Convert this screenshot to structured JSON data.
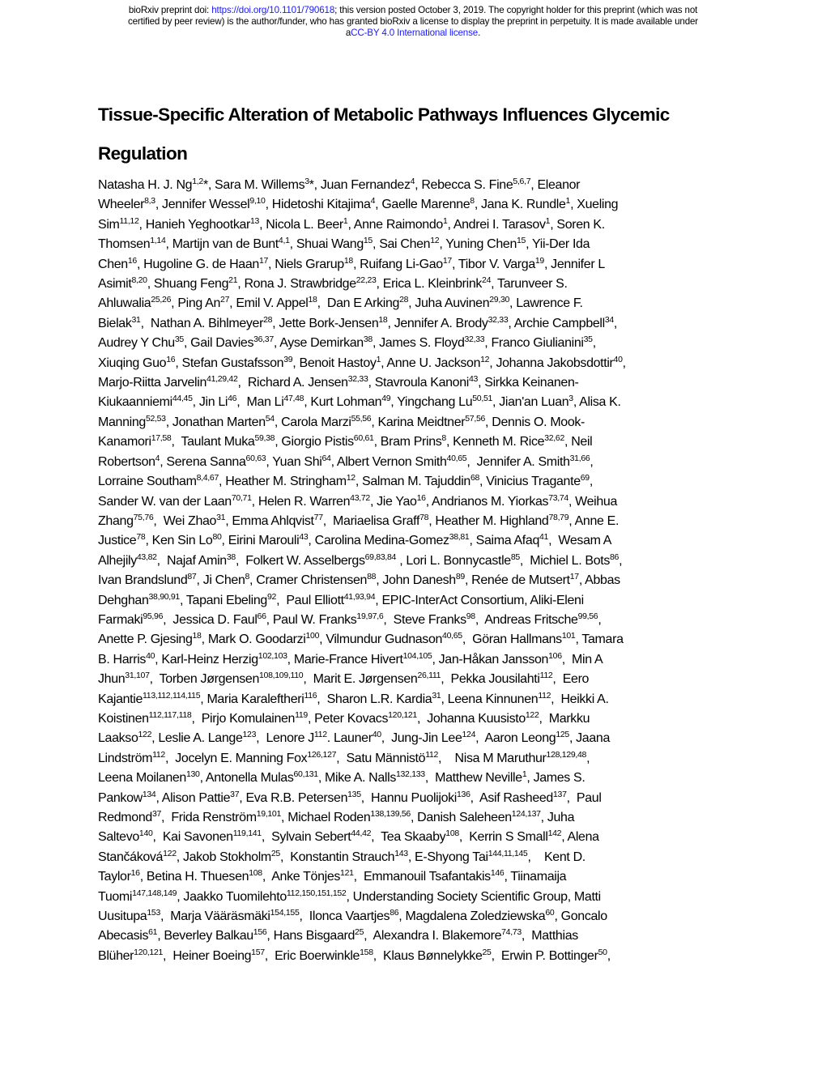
{
  "header_notice": {
    "prefix": "bioRxiv preprint doi: ",
    "doi_link": "https://doi.org/10.1101/790618",
    "line1_suffix": "; this version posted October 3, 2019. The copyright holder for this preprint (which was not",
    "line2": "certified by peer review) is the author/funder, who has granted bioRxiv a license to display the preprint in perpetuity. It is made available under",
    "line3_prefix": "a",
    "license_link": "CC-BY 4.0 International license",
    "line3_suffix": "."
  },
  "paper": {
    "title_line1": "Tissue-Specific Alteration of Metabolic Pathways Influences Glycemic",
    "title_line2": "Regulation"
  },
  "author_lines": [
    [
      [
        "Natasha H. J. Ng",
        "1,2",
        "*, "
      ],
      [
        "Sara M. Willems",
        "3",
        "*, "
      ],
      [
        "Juan Fernandez",
        "4",
        ", "
      ],
      [
        "Rebecca S. Fine",
        "5,6,7",
        ", "
      ],
      [
        "Eleanor",
        "",
        ""
      ]
    ],
    [
      [
        "Wheeler",
        "8,3",
        ", "
      ],
      [
        "Jennifer Wessel",
        "9,10",
        ", "
      ],
      [
        "Hidetoshi Kitajima",
        "4",
        ", "
      ],
      [
        "Gaelle Marenne",
        "8",
        ", "
      ],
      [
        "Jana K.  Rundle",
        "1",
        ", "
      ],
      [
        "Xueling",
        "",
        ""
      ]
    ],
    [
      [
        "Sim",
        "11,12",
        ", "
      ],
      [
        "Hanieh Yeghootkar",
        "13",
        ", "
      ],
      [
        "Nicola L. Beer",
        "1",
        ", "
      ],
      [
        "Anne Raimondo",
        "1",
        ", "
      ],
      [
        "Andrei I. Tarasov",
        "1",
        ", "
      ],
      [
        "Soren K.",
        "",
        ""
      ]
    ],
    [
      [
        "Thomsen",
        "1,14",
        ", "
      ],
      [
        "Martijn van de Bunt",
        "4,1",
        ", "
      ],
      [
        "Shuai Wang",
        "15",
        ", "
      ],
      [
        "Sai Chen",
        "12",
        ", "
      ],
      [
        "Yuning Chen",
        "15",
        ", "
      ],
      [
        "Yii-Der Ida",
        "",
        ""
      ]
    ],
    [
      [
        "Chen",
        "16",
        ", "
      ],
      [
        "Hugoline G. de Haan",
        "17",
        ", "
      ],
      [
        "Niels Grarup",
        "18",
        ", "
      ],
      [
        "Ruifang Li-Gao",
        "17",
        ", "
      ],
      [
        "Tibor V. Varga",
        "19",
        ", "
      ],
      [
        "Jennifer L",
        "",
        ""
      ]
    ],
    [
      [
        "Asimit",
        "8,20",
        ", "
      ],
      [
        "Shuang Feng",
        "21",
        ", "
      ],
      [
        "Rona J. Strawbridge",
        "22,23",
        ", "
      ],
      [
        "Erica L. Kleinbrink",
        "24",
        ", "
      ],
      [
        "Tarunveer S.",
        "",
        ""
      ]
    ],
    [
      [
        "Ahluwalia",
        "25,26",
        ", "
      ],
      [
        "Ping An",
        "27",
        ", "
      ],
      [
        "Emil V. Appel",
        "18",
        ",  "
      ],
      [
        "Dan E Arking",
        "28",
        ", "
      ],
      [
        "Juha Auvinen",
        "29,30",
        ", "
      ],
      [
        "Lawrence F.",
        "",
        ""
      ]
    ],
    [
      [
        "Bielak",
        "31",
        ",  "
      ],
      [
        "Nathan A. Bihlmeyer",
        "28",
        ", "
      ],
      [
        "Jette Bork-Jensen",
        "18",
        ", "
      ],
      [
        "Jennifer A. Brody",
        "32,33",
        ", "
      ],
      [
        "Archie Campbell",
        "34",
        ","
      ]
    ],
    [
      [
        "Audrey Y Chu",
        "35",
        ", "
      ],
      [
        "Gail Davies",
        "36,37",
        ", "
      ],
      [
        "Ayse Demirkan",
        "38",
        ", "
      ],
      [
        "James S. Floyd",
        "32,33",
        ", "
      ],
      [
        "Franco Giulianini",
        "35",
        ","
      ]
    ],
    [
      [
        "Xiuqing Guo",
        "16",
        ", "
      ],
      [
        "Stefan Gustafsson",
        "39",
        ", "
      ],
      [
        "Benoit Hastoy",
        "1",
        ", "
      ],
      [
        "Anne U. Jackson",
        "12",
        ", "
      ],
      [
        "Johanna Jakobsdottir",
        "40",
        ","
      ]
    ],
    [
      [
        "Marjo-Riitta Jarvelin",
        "41,29,42",
        ",  "
      ],
      [
        "Richard A. Jensen",
        "32,33",
        ", "
      ],
      [
        "Stavroula Kanoni",
        "43",
        ", "
      ],
      [
        "Sirkka Keinanen-",
        "",
        ""
      ]
    ],
    [
      [
        "Kiukaanniemi",
        "44,45",
        ", "
      ],
      [
        "Jin Li",
        "46",
        ",  "
      ],
      [
        "Man Li",
        "47,48",
        ", "
      ],
      [
        "Kurt Lohman",
        "49",
        ", "
      ],
      [
        "Yingchang Lu",
        "50,51",
        ", "
      ],
      [
        "Jian'an Luan",
        "3",
        ", "
      ],
      [
        "Alisa K.",
        "",
        ""
      ]
    ],
    [
      [
        "Manning",
        "52,53",
        ", "
      ],
      [
        "Jonathan Marten",
        "54",
        ", "
      ],
      [
        "Carola Marzi",
        "55,56",
        ", "
      ],
      [
        "Karina Meidtner",
        "57,56",
        ", "
      ],
      [
        "Dennis O. Mook-",
        "",
        ""
      ]
    ],
    [
      [
        "Kanamori",
        "17,58",
        ",  "
      ],
      [
        "Taulant Muka",
        "59,38",
        ", "
      ],
      [
        "Giorgio Pistis",
        "60,61",
        ", "
      ],
      [
        "Bram Prins",
        "8",
        ", "
      ],
      [
        "Kenneth M. Rice",
        "32,62",
        ", "
      ],
      [
        "Neil",
        "",
        ""
      ]
    ],
    [
      [
        "Robertson",
        "4",
        ", "
      ],
      [
        "Serena Sanna",
        "60,63",
        ", "
      ],
      [
        "Yuan Shi",
        "64",
        ", "
      ],
      [
        "Albert Vernon Smith",
        "40,65",
        ",  "
      ],
      [
        "Jennifer A. Smith",
        "31,66",
        ","
      ]
    ],
    [
      [
        "Lorraine Southam",
        "8,4,67",
        ", "
      ],
      [
        "Heather M. Stringham",
        "12",
        ", "
      ],
      [
        "Salman M. Tajuddin",
        "68",
        ", "
      ],
      [
        "Vinicius Tragante",
        "69",
        ","
      ]
    ],
    [
      [
        "Sander W. van der Laan",
        "70,71",
        ", "
      ],
      [
        "Helen R. Warren",
        "43,72",
        ", "
      ],
      [
        "Jie Yao",
        "16",
        ", "
      ],
      [
        "Andrianos M. Yiorkas",
        "73,74",
        ", "
      ],
      [
        "Weihua",
        "",
        ""
      ]
    ],
    [
      [
        "Zhang",
        "75,76",
        ",  "
      ],
      [
        "Wei Zhao",
        "31",
        ", "
      ],
      [
        "Emma Ahlqvist",
        "77",
        ",  "
      ],
      [
        "Mariaelisa Graff",
        "78",
        ", "
      ],
      [
        "Heather M. Highland",
        "78,79",
        ", "
      ],
      [
        "Anne E.",
        "",
        ""
      ]
    ],
    [
      [
        "Justice",
        "78",
        ", "
      ],
      [
        "Ken Sin Lo",
        "80",
        ", "
      ],
      [
        "Eirini Marouli",
        "43",
        ", "
      ],
      [
        "Carolina Medina-Gomez",
        "38,81",
        ", "
      ],
      [
        "Saima Afaq",
        "41",
        ",  "
      ],
      [
        "Wesam A",
        "",
        ""
      ]
    ],
    [
      [
        "Alhejily",
        "43,82",
        ",  "
      ],
      [
        "Najaf Amin",
        "38",
        ",  "
      ],
      [
        "Folkert W. Asselbergs",
        "69,83,84",
        " , "
      ],
      [
        "Lori L. Bonnycastle",
        "85",
        ",  "
      ],
      [
        "Michiel L. Bots",
        "86",
        ","
      ]
    ],
    [
      [
        "Ivan Brandslund",
        "87",
        ", "
      ],
      [
        "Ji Chen",
        "8",
        ", "
      ],
      [
        "Cramer Christensen",
        "88",
        ", "
      ],
      [
        "John Danesh",
        "89",
        ", "
      ],
      [
        "Renée de Mutsert",
        "17",
        ", "
      ],
      [
        "Abbas",
        "",
        ""
      ]
    ],
    [
      [
        "Dehghan",
        "38,90,91",
        ", "
      ],
      [
        "Tapani Ebeling",
        "92",
        ",  "
      ],
      [
        "Paul Elliott",
        "41,93,94",
        ", "
      ],
      [
        "EPIC-InterAct Consortium, ",
        "",
        ""
      ],
      [
        "Aliki-Eleni",
        "",
        ""
      ]
    ],
    [
      [
        "Farmaki",
        "95,96",
        ",  "
      ],
      [
        "Jessica D. Faul",
        "66",
        ", "
      ],
      [
        "Paul W. Franks",
        "19,97,6",
        ",  "
      ],
      [
        "Steve Franks",
        "98",
        ",  "
      ],
      [
        "Andreas Fritsche",
        "99,56",
        ","
      ]
    ],
    [
      [
        "Anette P. Gjesing",
        "18",
        ", "
      ],
      [
        "Mark O. Goodarzi",
        "100",
        ", "
      ],
      [
        "Vilmundur Gudnason",
        "40,65",
        ",  "
      ],
      [
        "Göran Hallmans",
        "101",
        ", "
      ],
      [
        "Tamara",
        "",
        ""
      ]
    ],
    [
      [
        "B. Harris",
        "40",
        ", "
      ],
      [
        "Karl-Heinz  Herzig",
        "102,103",
        ", "
      ],
      [
        "Marie-France Hivert",
        "104,105",
        ", "
      ],
      [
        "Jan-Håkan Jansson",
        "106",
        ",  "
      ],
      [
        "Min A",
        "",
        ""
      ]
    ],
    [
      [
        "Jhun",
        "31,107",
        ",  "
      ],
      [
        "Torben Jørgensen",
        "108,109,110",
        ",  "
      ],
      [
        "Marit E. Jørgensen",
        "26,111",
        ",  "
      ],
      [
        "Pekka Jousilahti",
        "112",
        ",  "
      ],
      [
        "Eero",
        "",
        ""
      ]
    ],
    [
      [
        "Kajantie",
        "113,112,114,115",
        ", "
      ],
      [
        "Maria Karaleftheri",
        "116",
        ",  "
      ],
      [
        "Sharon L.R. Kardia",
        "31",
        ", "
      ],
      [
        "Leena Kinnunen",
        "112",
        ",  "
      ],
      [
        "Heikki A.",
        "",
        ""
      ]
    ],
    [
      [
        "Koistinen",
        "112,117,118",
        ",  "
      ],
      [
        "Pirjo Komulainen",
        "119",
        ", "
      ],
      [
        "Peter Kovacs",
        "120,121",
        ",  "
      ],
      [
        "Johanna Kuusisto",
        "122",
        ",  "
      ],
      [
        "Markku",
        "",
        ""
      ]
    ],
    [
      [
        "Laakso",
        "122",
        ", "
      ],
      [
        "Leslie A. Lange",
        "123",
        ",  "
      ],
      [
        "Lenore J",
        "112",
        ". "
      ],
      [
        "Launer",
        "40",
        ",  "
      ],
      [
        "Jung-Jin Lee",
        "124",
        ",  "
      ],
      [
        "Aaron Leong",
        "125",
        ", "
      ],
      [
        "Jaana",
        "",
        ""
      ]
    ],
    [
      [
        "Lindström",
        "112",
        ",  "
      ],
      [
        "Jocelyn E.  Manning Fox",
        "126,127",
        ",  "
      ],
      [
        "Satu Männistö",
        "112",
        ",    "
      ],
      [
        "Nisa M Maruthur",
        "128,129,48",
        ","
      ]
    ],
    [
      [
        "Leena Moilanen",
        "130",
        ", "
      ],
      [
        "Antonella Mulas",
        "60,131",
        ", "
      ],
      [
        "Mike A. Nalls",
        "132,133",
        ",  "
      ],
      [
        "Matthew Neville",
        "1",
        ", "
      ],
      [
        "James S.",
        "",
        ""
      ]
    ],
    [
      [
        "Pankow",
        "134",
        ", "
      ],
      [
        "Alison Pattie",
        "37",
        ", "
      ],
      [
        "Eva R.B. Petersen",
        "135",
        ",  "
      ],
      [
        "Hannu Puolijoki",
        "136",
        ",  "
      ],
      [
        "Asif Rasheed",
        "137",
        ",  "
      ],
      [
        "Paul",
        "",
        ""
      ]
    ],
    [
      [
        "Redmond",
        "37",
        ",  "
      ],
      [
        "Frida Renström",
        "19,101",
        ", "
      ],
      [
        "Michael Roden",
        "138,139,56",
        ", "
      ],
      [
        "Danish Saleheen",
        "124,137",
        ", "
      ],
      [
        "Juha",
        "",
        ""
      ]
    ],
    [
      [
        "Saltevo",
        "140",
        ",  "
      ],
      [
        "Kai Savonen",
        "119,141",
        ",  "
      ],
      [
        "Sylvain Sebert",
        "44,42",
        ",  "
      ],
      [
        "Tea Skaaby",
        "108",
        ",  "
      ],
      [
        "Kerrin S Small",
        "142",
        ", "
      ],
      [
        "Alena",
        "",
        ""
      ]
    ],
    [
      [
        "Stančáková",
        "122",
        ", "
      ],
      [
        "Jakob Stokholm",
        "25",
        ",  "
      ],
      [
        "Konstantin Strauch",
        "143",
        ", "
      ],
      [
        "E-Shyong Tai",
        "144,11,145",
        ",    "
      ],
      [
        "Kent D.",
        "",
        ""
      ]
    ],
    [
      [
        "Taylor",
        "16",
        ", "
      ],
      [
        "Betina H. Thuesen",
        "108",
        ",  "
      ],
      [
        "Anke Tönjes",
        "121",
        ",  "
      ],
      [
        "Emmanouil Tsafantakis",
        "146",
        ", "
      ],
      [
        "Tiinamaija",
        "",
        ""
      ]
    ],
    [
      [
        "Tuomi",
        "147,148,149",
        ", "
      ],
      [
        "Jaakko Tuomilehto",
        "112,150,151,152",
        ", "
      ],
      [
        "Understanding Society Scientific Group,  ",
        "",
        ""
      ],
      [
        "Matti",
        "",
        ""
      ]
    ],
    [
      [
        "Uusitupa",
        "153",
        ",  "
      ],
      [
        "Marja Vääräsmäki",
        "154,155",
        ",  "
      ],
      [
        "Ilonca Vaartjes",
        "86",
        ", "
      ],
      [
        "Magdalena Zoledziewska",
        "60",
        ", "
      ],
      [
        "Goncalo",
        "",
        ""
      ]
    ],
    [
      [
        "Abecasis",
        "61",
        ", "
      ],
      [
        "Beverley Balkau",
        "156",
        ", "
      ],
      [
        "Hans Bisgaard",
        "25",
        ",  "
      ],
      [
        "Alexandra I. Blakemore",
        "74,73",
        ",  "
      ],
      [
        "Matthias",
        "",
        ""
      ]
    ],
    [
      [
        "Blüher",
        "120,121",
        ",  "
      ],
      [
        "Heiner Boeing",
        "157",
        ",  "
      ],
      [
        "Eric Boerwinkle",
        "158",
        ",  "
      ],
      [
        "Klaus Bønnelykke",
        "25",
        ",  "
      ],
      [
        "Erwin P. Bottinger",
        "50",
        ","
      ]
    ]
  ]
}
